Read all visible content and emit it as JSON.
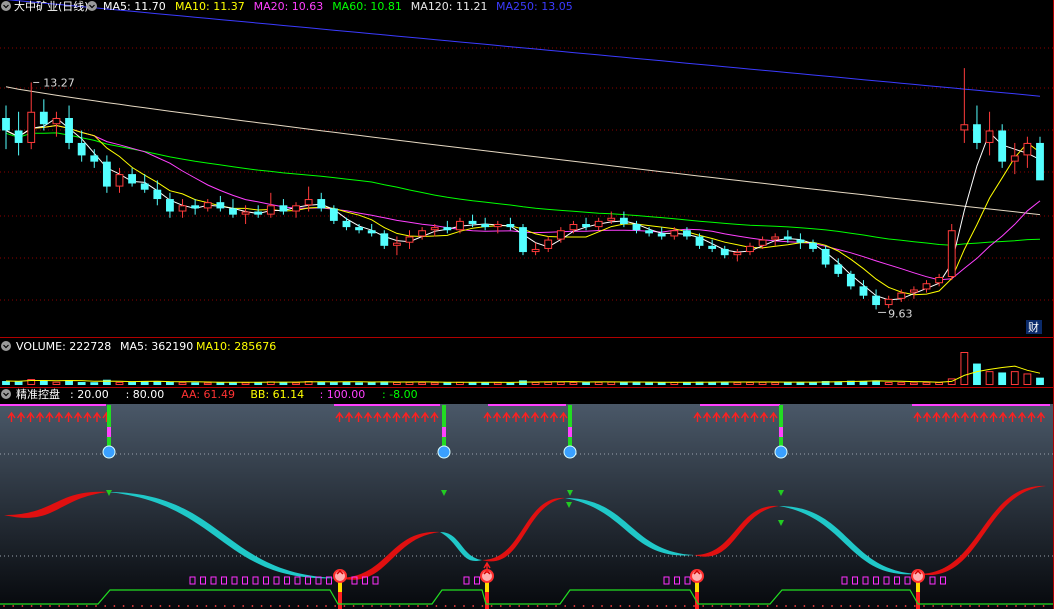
{
  "stock": {
    "name": "大中矿业",
    "period": "(日线)",
    "period_full": "大中矿业(日线)"
  },
  "main_panel": {
    "indicators": [
      {
        "label": "MA5",
        "value": "11.70",
        "color": "#ffffff"
      },
      {
        "label": "MA10",
        "value": "11.37",
        "color": "#ffff00"
      },
      {
        "label": "MA20",
        "value": "10.63",
        "color": "#ff40ff"
      },
      {
        "label": "MA60",
        "value": "10.81",
        "color": "#00ff00"
      },
      {
        "label": "MA120",
        "value": "11.21",
        "color": "#e6e6e6"
      },
      {
        "label": "MA250",
        "value": "13.05",
        "color": "#3b3bff"
      }
    ],
    "high_label": "13.27",
    "low_label": "9.63",
    "cai_badge": "财"
  },
  "volume_panel": {
    "title": "VOLUME",
    "volume": "222728",
    "ma5_label": "MA5",
    "ma5": "362190",
    "ma10_label": "MA10",
    "ma10": "285676"
  },
  "indicator_panel": {
    "title": "精准控盘",
    "params": [
      {
        "text": ": 20.00",
        "color": "#ffffff"
      },
      {
        "text": ": 80.00",
        "color": "#ffffff"
      },
      {
        "text": "AA: 61.49",
        "color": "#ff3333"
      },
      {
        "text": "BB: 61.14",
        "color": "#ffff00"
      },
      {
        "text": ": 100.00",
        "color": "#ff40ff"
      },
      {
        "text": ": -8.00",
        "color": "#00ff00"
      }
    ]
  },
  "colors": {
    "up": "#ff3b3b",
    "down": "#54ffff",
    "ma5": "#ffffff",
    "ma10": "#ffff00",
    "ma20": "#ff40ff",
    "ma60": "#00ff00",
    "ma120": "#e6d9c3",
    "ma250": "#3b3bff",
    "grid": "#8b0000",
    "band_up": "#e01010",
    "band_down": "#20c8c8"
  },
  "chart_data": {
    "type": "candlestick",
    "ylim": [
      9.3,
      14.4
    ],
    "candles": [
      [
        12.7,
        12.9,
        12.2,
        12.5
      ],
      [
        12.5,
        12.8,
        12.1,
        12.3
      ],
      [
        12.3,
        13.27,
        12.2,
        12.8
      ],
      [
        12.8,
        13.0,
        12.5,
        12.6
      ],
      [
        12.6,
        12.8,
        12.4,
        12.7
      ],
      [
        12.7,
        12.9,
        12.2,
        12.3
      ],
      [
        12.3,
        12.5,
        12.0,
        12.1
      ],
      [
        12.1,
        12.2,
        11.9,
        12.0
      ],
      [
        12.0,
        12.1,
        11.5,
        11.6
      ],
      [
        11.6,
        11.9,
        11.5,
        11.8
      ],
      [
        11.8,
        11.9,
        11.6,
        11.65
      ],
      [
        11.65,
        11.8,
        11.5,
        11.55
      ],
      [
        11.55,
        11.7,
        11.3,
        11.4
      ],
      [
        11.4,
        11.5,
        11.1,
        11.2
      ],
      [
        11.2,
        11.4,
        11.1,
        11.3
      ],
      [
        11.3,
        11.4,
        11.15,
        11.25
      ],
      [
        11.25,
        11.4,
        11.2,
        11.35
      ],
      [
        11.35,
        11.45,
        11.2,
        11.25
      ],
      [
        11.25,
        11.4,
        11.1,
        11.15
      ],
      [
        11.15,
        11.3,
        11.0,
        11.2
      ],
      [
        11.2,
        11.3,
        11.1,
        11.15
      ],
      [
        11.15,
        11.5,
        11.1,
        11.3
      ],
      [
        11.3,
        11.4,
        11.15,
        11.2
      ],
      [
        11.2,
        11.35,
        11.1,
        11.3
      ],
      [
        11.3,
        11.6,
        11.2,
        11.4
      ],
      [
        11.4,
        11.5,
        11.2,
        11.25
      ],
      [
        11.25,
        11.3,
        11.0,
        11.05
      ],
      [
        11.05,
        11.1,
        10.9,
        10.95
      ],
      [
        10.95,
        11.0,
        10.85,
        10.9
      ],
      [
        10.9,
        11.0,
        10.8,
        10.85
      ],
      [
        10.85,
        10.9,
        10.6,
        10.65
      ],
      [
        10.65,
        10.8,
        10.5,
        10.7
      ],
      [
        10.7,
        10.9,
        10.6,
        10.8
      ],
      [
        10.8,
        10.95,
        10.75,
        10.9
      ],
      [
        10.9,
        11.0,
        10.8,
        10.95
      ],
      [
        10.95,
        11.05,
        10.85,
        10.9
      ],
      [
        10.9,
        11.1,
        10.85,
        11.05
      ],
      [
        11.05,
        11.15,
        10.95,
        11.0
      ],
      [
        11.0,
        11.1,
        10.9,
        10.95
      ],
      [
        10.95,
        11.05,
        10.85,
        11.0
      ],
      [
        11.0,
        11.1,
        10.9,
        10.95
      ],
      [
        10.95,
        11.0,
        10.5,
        10.55
      ],
      [
        10.55,
        10.7,
        10.5,
        10.6
      ],
      [
        10.6,
        10.8,
        10.55,
        10.75
      ],
      [
        10.75,
        10.95,
        10.7,
        10.9
      ],
      [
        10.9,
        11.05,
        10.85,
        11.0
      ],
      [
        11.0,
        11.1,
        10.9,
        10.95
      ],
      [
        10.95,
        11.1,
        10.9,
        11.05
      ],
      [
        11.05,
        11.2,
        11.0,
        11.1
      ],
      [
        11.1,
        11.2,
        10.95,
        11.0
      ],
      [
        11.0,
        11.05,
        10.85,
        10.9
      ],
      [
        10.9,
        10.95,
        10.8,
        10.85
      ],
      [
        10.85,
        10.95,
        10.75,
        10.8
      ],
      [
        10.8,
        10.95,
        10.75,
        10.9
      ],
      [
        10.9,
        10.95,
        10.75,
        10.8
      ],
      [
        10.8,
        10.85,
        10.6,
        10.65
      ],
      [
        10.65,
        10.75,
        10.55,
        10.6
      ],
      [
        10.6,
        10.65,
        10.45,
        10.5
      ],
      [
        10.5,
        10.6,
        10.4,
        10.55
      ],
      [
        10.55,
        10.7,
        10.5,
        10.65
      ],
      [
        10.65,
        10.8,
        10.6,
        10.75
      ],
      [
        10.75,
        10.85,
        10.65,
        10.8
      ],
      [
        10.8,
        10.9,
        10.7,
        10.75
      ],
      [
        10.75,
        10.85,
        10.6,
        10.7
      ],
      [
        10.7,
        10.75,
        10.55,
        10.6
      ],
      [
        10.6,
        10.65,
        10.3,
        10.35
      ],
      [
        10.35,
        10.45,
        10.15,
        10.2
      ],
      [
        10.2,
        10.25,
        9.95,
        10.0
      ],
      [
        10.0,
        10.1,
        9.8,
        9.85
      ],
      [
        9.85,
        9.95,
        9.63,
        9.7
      ],
      [
        9.7,
        9.85,
        9.65,
        9.8
      ],
      [
        9.8,
        9.95,
        9.75,
        9.9
      ],
      [
        9.9,
        10.0,
        9.8,
        9.95
      ],
      [
        9.95,
        10.1,
        9.9,
        10.05
      ],
      [
        10.05,
        10.2,
        10.0,
        10.15
      ],
      [
        10.15,
        11.0,
        10.1,
        10.9
      ],
      [
        12.5,
        13.5,
        12.3,
        12.6
      ],
      [
        12.6,
        12.9,
        12.2,
        12.3
      ],
      [
        12.3,
        12.8,
        12.1,
        12.5
      ],
      [
        12.5,
        12.6,
        11.9,
        12.0
      ],
      [
        12.0,
        12.3,
        11.8,
        12.1
      ],
      [
        12.1,
        12.4,
        11.9,
        12.3
      ],
      [
        12.3,
        12.4,
        11.9,
        11.7
      ]
    ],
    "volume_ylim": [
      0,
      1000000
    ],
    "volumes": [
      120000,
      110000,
      180000,
      140000,
      100000,
      150000,
      90000,
      85000,
      160000,
      95000,
      90000,
      110000,
      120000,
      100000,
      85000,
      80000,
      75000,
      90000,
      85000,
      80000,
      80000,
      110000,
      85000,
      80000,
      120000,
      90000,
      100000,
      95000,
      80000,
      85000,
      110000,
      90000,
      95000,
      85000,
      80000,
      75000,
      95000,
      80000,
      75000,
      80000,
      70000,
      140000,
      90000,
      95000,
      100000,
      90000,
      85000,
      95000,
      100000,
      90000,
      80000,
      75000,
      80000,
      90000,
      85000,
      100000,
      90000,
      95000,
      85000,
      90000,
      95000,
      85000,
      80000,
      85000,
      90000,
      120000,
      110000,
      130000,
      120000,
      140000,
      90000,
      85000,
      80000,
      85000,
      90000,
      200000,
      1000000,
      650000,
      420000,
      380000,
      420000,
      350000,
      222728
    ],
    "indicator": {
      "ylim": [
        -10,
        110
      ],
      "reference_lines": [
        20,
        80,
        100,
        -8
      ],
      "AA": 61.49,
      "BB": 61.14
    }
  }
}
